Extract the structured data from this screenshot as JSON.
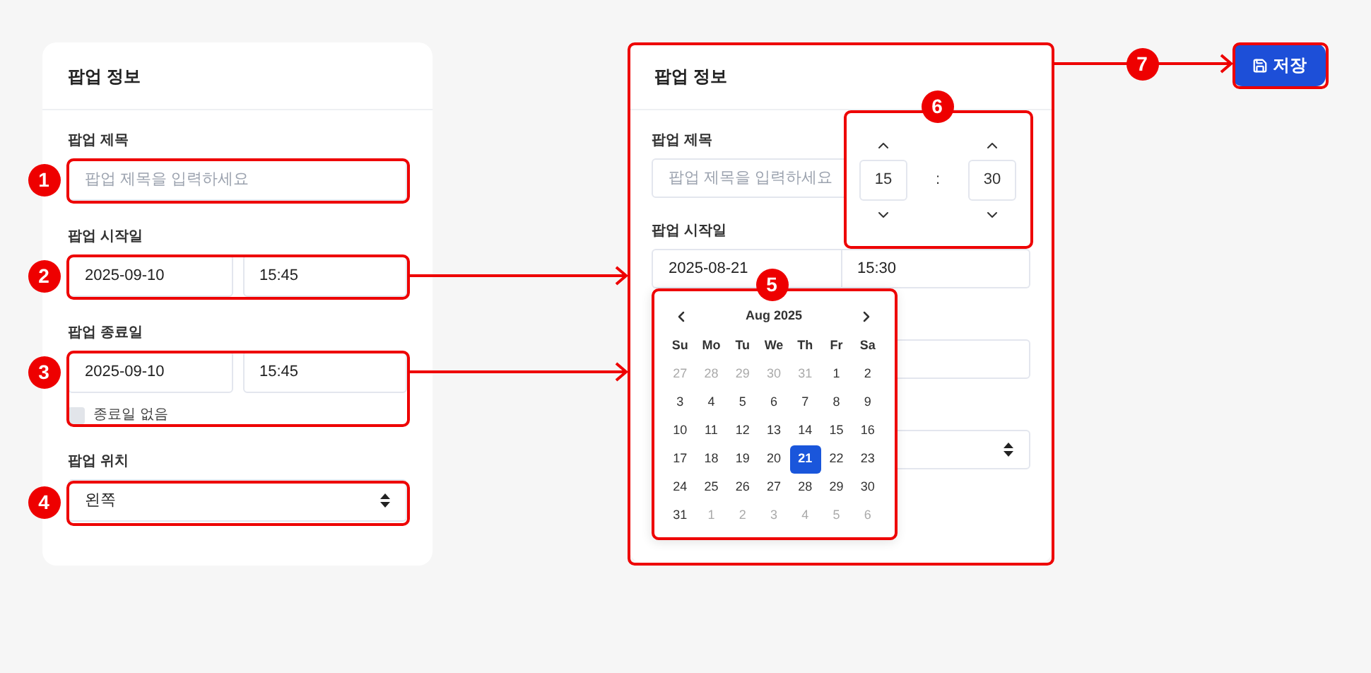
{
  "left_panel": {
    "title": "팝업 정보",
    "fields": [
      {
        "kind": "text",
        "label": "팝업 제목",
        "placeholder": "팝업 제목을 입력하세요"
      },
      {
        "kind": "datetime",
        "label": "팝업 시작일",
        "date": "2025-09-10",
        "time": "15:45"
      },
      {
        "kind": "datetime",
        "label": "팝업 종료일",
        "date": "2025-09-10",
        "time": "15:45",
        "checkbox": {
          "label": "종료일 없음",
          "checked": false
        }
      },
      {
        "kind": "select",
        "label": "팝업 위치",
        "value": "왼쪽"
      }
    ]
  },
  "right_panel": {
    "title": "팝업 정보",
    "fields": [
      {
        "kind": "text",
        "label": "팝업 제목",
        "placeholder": "팝업 제목을 입력하세요"
      },
      {
        "kind": "datetime",
        "label": "팝업 시작일",
        "date": "2025-08-21",
        "time": "15:30"
      },
      {
        "kind": "blank"
      },
      {
        "kind": "select"
      }
    ],
    "calendar": {
      "month": "Aug 2025",
      "weekdays": [
        "Su",
        "Mo",
        "Tu",
        "We",
        "Th",
        "Fr",
        "Sa"
      ],
      "weeks": [
        [
          {
            "day": "27",
            "muted": true,
            "selected": false
          },
          {
            "day": "28",
            "muted": true,
            "selected": false
          },
          {
            "day": "29",
            "muted": true,
            "selected": false
          },
          {
            "day": "30",
            "muted": true,
            "selected": false
          },
          {
            "day": "31",
            "muted": true,
            "selected": false
          },
          {
            "day": "1",
            "muted": false,
            "selected": false
          },
          {
            "day": "2",
            "muted": false,
            "selected": false
          }
        ],
        [
          {
            "day": "3",
            "muted": false,
            "selected": false
          },
          {
            "day": "4",
            "muted": false,
            "selected": false
          },
          {
            "day": "5",
            "muted": false,
            "selected": false
          },
          {
            "day": "6",
            "muted": false,
            "selected": false
          },
          {
            "day": "7",
            "muted": false,
            "selected": false
          },
          {
            "day": "8",
            "muted": false,
            "selected": false
          },
          {
            "day": "9",
            "muted": false,
            "selected": false
          }
        ],
        [
          {
            "day": "10",
            "muted": false,
            "selected": false
          },
          {
            "day": "11",
            "muted": false,
            "selected": false
          },
          {
            "day": "12",
            "muted": false,
            "selected": false
          },
          {
            "day": "13",
            "muted": false,
            "selected": false
          },
          {
            "day": "14",
            "muted": false,
            "selected": false
          },
          {
            "day": "15",
            "muted": false,
            "selected": false
          },
          {
            "day": "16",
            "muted": false,
            "selected": false
          }
        ],
        [
          {
            "day": "17",
            "muted": false,
            "selected": false
          },
          {
            "day": "18",
            "muted": false,
            "selected": false
          },
          {
            "day": "19",
            "muted": false,
            "selected": false
          },
          {
            "day": "20",
            "muted": false,
            "selected": false
          },
          {
            "day": "21",
            "muted": false,
            "selected": true
          },
          {
            "day": "22",
            "muted": false,
            "selected": false
          },
          {
            "day": "23",
            "muted": false,
            "selected": false
          }
        ],
        [
          {
            "day": "24",
            "muted": false,
            "selected": false
          },
          {
            "day": "25",
            "muted": false,
            "selected": false
          },
          {
            "day": "26",
            "muted": false,
            "selected": false
          },
          {
            "day": "27",
            "muted": false,
            "selected": false
          },
          {
            "day": "28",
            "muted": false,
            "selected": false
          },
          {
            "day": "29",
            "muted": false,
            "selected": false
          },
          {
            "day": "30",
            "muted": false,
            "selected": false
          }
        ],
        [
          {
            "day": "31",
            "muted": false,
            "selected": false
          },
          {
            "day": "1",
            "muted": true,
            "selected": false
          },
          {
            "day": "2",
            "muted": true,
            "selected": false
          },
          {
            "day": "3",
            "muted": true,
            "selected": false
          },
          {
            "day": "4",
            "muted": true,
            "selected": false
          },
          {
            "day": "5",
            "muted": true,
            "selected": false
          },
          {
            "day": "6",
            "muted": true,
            "selected": false
          }
        ]
      ]
    },
    "time_picker": {
      "hour": "15",
      "separator": ":",
      "minute": "30"
    }
  },
  "save_button": {
    "label": "저장"
  },
  "annotations": [
    {
      "number": "1"
    },
    {
      "number": "2"
    },
    {
      "number": "3"
    },
    {
      "number": "4"
    },
    {
      "number": "5"
    },
    {
      "number": "6"
    },
    {
      "number": "7"
    }
  ]
}
